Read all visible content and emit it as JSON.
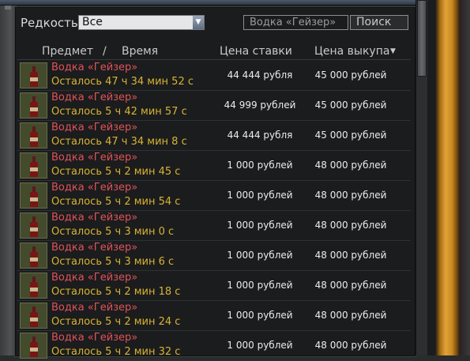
{
  "filter": {
    "rarity_label": "Редкость",
    "rarity_value": "Все",
    "search_value": "Водка «Гейзер»",
    "search_button": "Поиск"
  },
  "columns": {
    "item": "Предмет",
    "separator": "/",
    "time": "Время",
    "bid": "Цена ставки",
    "buyout": "Цена выкупа"
  },
  "sort_icon": "triangle-down-icon",
  "colors": {
    "item_name": "#e0535a",
    "time_left": "#d7b433",
    "price": "#ececec",
    "accent_frame": "#e2a23a"
  },
  "rows": [
    {
      "icon": "vodka-bottle-icon",
      "name": "Водка «Гейзер»",
      "time": "Осталось 47 ч 34 мин 52 с",
      "bid": "44 444 рубля",
      "buyout": "45 000 рублей"
    },
    {
      "icon": "vodka-bottle-icon",
      "name": "Водка «Гейзер»",
      "time": "Осталось 5 ч 42 мин 57 с",
      "bid": "44 999 рублей",
      "buyout": "45 000 рублей"
    },
    {
      "icon": "vodka-bottle-icon",
      "name": "Водка «Гейзер»",
      "time": "Осталось 47 ч 34 мин 8 с",
      "bid": "44 444 рубля",
      "buyout": "45 000 рублей"
    },
    {
      "icon": "vodka-bottle-icon",
      "name": "Водка «Гейзер»",
      "time": "Осталось 5 ч 2 мин 45 с",
      "bid": "1 000 рублей",
      "buyout": "48 000 рублей"
    },
    {
      "icon": "vodka-bottle-icon",
      "name": "Водка «Гейзер»",
      "time": "Осталось 5 ч 2 мин 54 с",
      "bid": "1 000 рублей",
      "buyout": "48 000 рублей"
    },
    {
      "icon": "vodka-bottle-icon",
      "name": "Водка «Гейзер»",
      "time": "Осталось 5 ч 3 мин 0 с",
      "bid": "1 000 рублей",
      "buyout": "48 000 рублей"
    },
    {
      "icon": "vodka-bottle-icon",
      "name": "Водка «Гейзер»",
      "time": "Осталось 5 ч 3 мин 6 с",
      "bid": "1 000 рублей",
      "buyout": "48 000 рублей"
    },
    {
      "icon": "vodka-bottle-icon",
      "name": "Водка «Гейзер»",
      "time": "Осталось 5 ч 2 мин 18 с",
      "bid": "1 000 рублей",
      "buyout": "48 000 рублей"
    },
    {
      "icon": "vodka-bottle-icon",
      "name": "Водка «Гейзер»",
      "time": "Осталось 5 ч 2 мин 24 с",
      "bid": "1 000 рублей",
      "buyout": "48 000 рублей"
    },
    {
      "icon": "vodka-bottle-icon",
      "name": "Водка «Гейзер»",
      "time": "Осталось 5 ч 2 мин 32 с",
      "bid": "1 000 рублей",
      "buyout": "48 000 рублей"
    }
  ]
}
